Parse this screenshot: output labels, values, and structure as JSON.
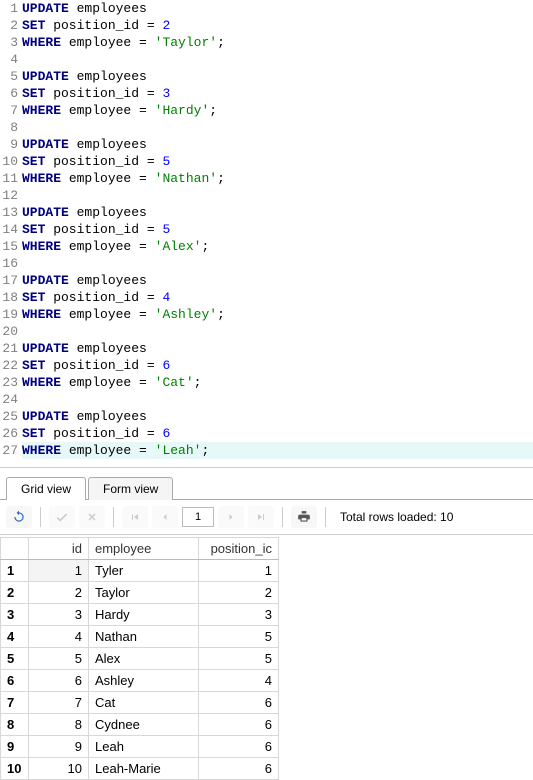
{
  "editor": {
    "lines": [
      [
        {
          "t": "UPDATE",
          "c": "kw"
        },
        {
          "t": " employees",
          "c": "ident"
        }
      ],
      [
        {
          "t": "SET",
          "c": "kw"
        },
        {
          "t": " position_id ",
          "c": "ident"
        },
        {
          "t": "=",
          "c": "ident"
        },
        {
          "t": " ",
          "c": "ident"
        },
        {
          "t": "2",
          "c": "num"
        }
      ],
      [
        {
          "t": "WHERE",
          "c": "kw"
        },
        {
          "t": " employee ",
          "c": "ident"
        },
        {
          "t": "=",
          "c": "ident"
        },
        {
          "t": " ",
          "c": "ident"
        },
        {
          "t": "'Taylor'",
          "c": "str"
        },
        {
          "t": ";",
          "c": "ident"
        }
      ],
      [],
      [
        {
          "t": "UPDATE",
          "c": "kw"
        },
        {
          "t": " employees",
          "c": "ident"
        }
      ],
      [
        {
          "t": "SET",
          "c": "kw"
        },
        {
          "t": " position_id ",
          "c": "ident"
        },
        {
          "t": "=",
          "c": "ident"
        },
        {
          "t": " ",
          "c": "ident"
        },
        {
          "t": "3",
          "c": "num"
        }
      ],
      [
        {
          "t": "WHERE",
          "c": "kw"
        },
        {
          "t": " employee ",
          "c": "ident"
        },
        {
          "t": "=",
          "c": "ident"
        },
        {
          "t": " ",
          "c": "ident"
        },
        {
          "t": "'Hardy'",
          "c": "str"
        },
        {
          "t": ";",
          "c": "ident"
        }
      ],
      [],
      [
        {
          "t": "UPDATE",
          "c": "kw"
        },
        {
          "t": " employees",
          "c": "ident"
        }
      ],
      [
        {
          "t": "SET",
          "c": "kw"
        },
        {
          "t": " position_id ",
          "c": "ident"
        },
        {
          "t": "=",
          "c": "ident"
        },
        {
          "t": " ",
          "c": "ident"
        },
        {
          "t": "5",
          "c": "num"
        }
      ],
      [
        {
          "t": "WHERE",
          "c": "kw"
        },
        {
          "t": " employee ",
          "c": "ident"
        },
        {
          "t": "=",
          "c": "ident"
        },
        {
          "t": " ",
          "c": "ident"
        },
        {
          "t": "'Nathan'",
          "c": "str"
        },
        {
          "t": ";",
          "c": "ident"
        }
      ],
      [],
      [
        {
          "t": "UPDATE",
          "c": "kw"
        },
        {
          "t": " employees",
          "c": "ident"
        }
      ],
      [
        {
          "t": "SET",
          "c": "kw"
        },
        {
          "t": " position_id ",
          "c": "ident"
        },
        {
          "t": "=",
          "c": "ident"
        },
        {
          "t": " ",
          "c": "ident"
        },
        {
          "t": "5",
          "c": "num"
        }
      ],
      [
        {
          "t": "WHERE",
          "c": "kw"
        },
        {
          "t": " employee ",
          "c": "ident"
        },
        {
          "t": "=",
          "c": "ident"
        },
        {
          "t": " ",
          "c": "ident"
        },
        {
          "t": "'Alex'",
          "c": "str"
        },
        {
          "t": ";",
          "c": "ident"
        }
      ],
      [],
      [
        {
          "t": "UPDATE",
          "c": "kw"
        },
        {
          "t": " employees",
          "c": "ident"
        }
      ],
      [
        {
          "t": "SET",
          "c": "kw"
        },
        {
          "t": " position_id ",
          "c": "ident"
        },
        {
          "t": "=",
          "c": "ident"
        },
        {
          "t": " ",
          "c": "ident"
        },
        {
          "t": "4",
          "c": "num"
        }
      ],
      [
        {
          "t": "WHERE",
          "c": "kw"
        },
        {
          "t": " employee ",
          "c": "ident"
        },
        {
          "t": "=",
          "c": "ident"
        },
        {
          "t": " ",
          "c": "ident"
        },
        {
          "t": "'Ashley'",
          "c": "str"
        },
        {
          "t": ";",
          "c": "ident"
        }
      ],
      [],
      [
        {
          "t": "UPDATE",
          "c": "kw"
        },
        {
          "t": " employees",
          "c": "ident"
        }
      ],
      [
        {
          "t": "SET",
          "c": "kw"
        },
        {
          "t": " position_id ",
          "c": "ident"
        },
        {
          "t": "=",
          "c": "ident"
        },
        {
          "t": " ",
          "c": "ident"
        },
        {
          "t": "6",
          "c": "num"
        }
      ],
      [
        {
          "t": "WHERE",
          "c": "kw"
        },
        {
          "t": " employee ",
          "c": "ident"
        },
        {
          "t": "=",
          "c": "ident"
        },
        {
          "t": " ",
          "c": "ident"
        },
        {
          "t": "'Cat'",
          "c": "str"
        },
        {
          "t": ";",
          "c": "ident"
        }
      ],
      [],
      [
        {
          "t": "UPDATE",
          "c": "kw"
        },
        {
          "t": " employees",
          "c": "ident"
        }
      ],
      [
        {
          "t": "SET",
          "c": "kw"
        },
        {
          "t": " position_id ",
          "c": "ident"
        },
        {
          "t": "=",
          "c": "ident"
        },
        {
          "t": " ",
          "c": "ident"
        },
        {
          "t": "6",
          "c": "num"
        }
      ],
      [
        {
          "t": "WHERE",
          "c": "kw"
        },
        {
          "t": " employee ",
          "c": "ident"
        },
        {
          "t": "=",
          "c": "ident"
        },
        {
          "t": " ",
          "c": "ident"
        },
        {
          "t": "'Leah'",
          "c": "str"
        },
        {
          "t": ";",
          "c": "ident"
        }
      ]
    ],
    "highlight_line": 27
  },
  "tabs": {
    "grid": "Grid view",
    "form": "Form view",
    "active": "grid"
  },
  "toolbar": {
    "page": "1",
    "total_label": "Total rows loaded: 10"
  },
  "grid": {
    "columns": [
      "id",
      "employee",
      "position_ic"
    ],
    "rows": [
      {
        "n": "1",
        "id": "1",
        "employee": "Tyler",
        "position": "1"
      },
      {
        "n": "2",
        "id": "2",
        "employee": "Taylor",
        "position": "2"
      },
      {
        "n": "3",
        "id": "3",
        "employee": "Hardy",
        "position": "3"
      },
      {
        "n": "4",
        "id": "4",
        "employee": "Nathan",
        "position": "5"
      },
      {
        "n": "5",
        "id": "5",
        "employee": "Alex",
        "position": "5"
      },
      {
        "n": "6",
        "id": "6",
        "employee": "Ashley",
        "position": "4"
      },
      {
        "n": "7",
        "id": "7",
        "employee": "Cat",
        "position": "6"
      },
      {
        "n": "8",
        "id": "8",
        "employee": "Cydnee",
        "position": "6"
      },
      {
        "n": "9",
        "id": "9",
        "employee": "Leah",
        "position": "6"
      },
      {
        "n": "10",
        "id": "10",
        "employee": "Leah-Marie",
        "position": "6"
      }
    ]
  }
}
